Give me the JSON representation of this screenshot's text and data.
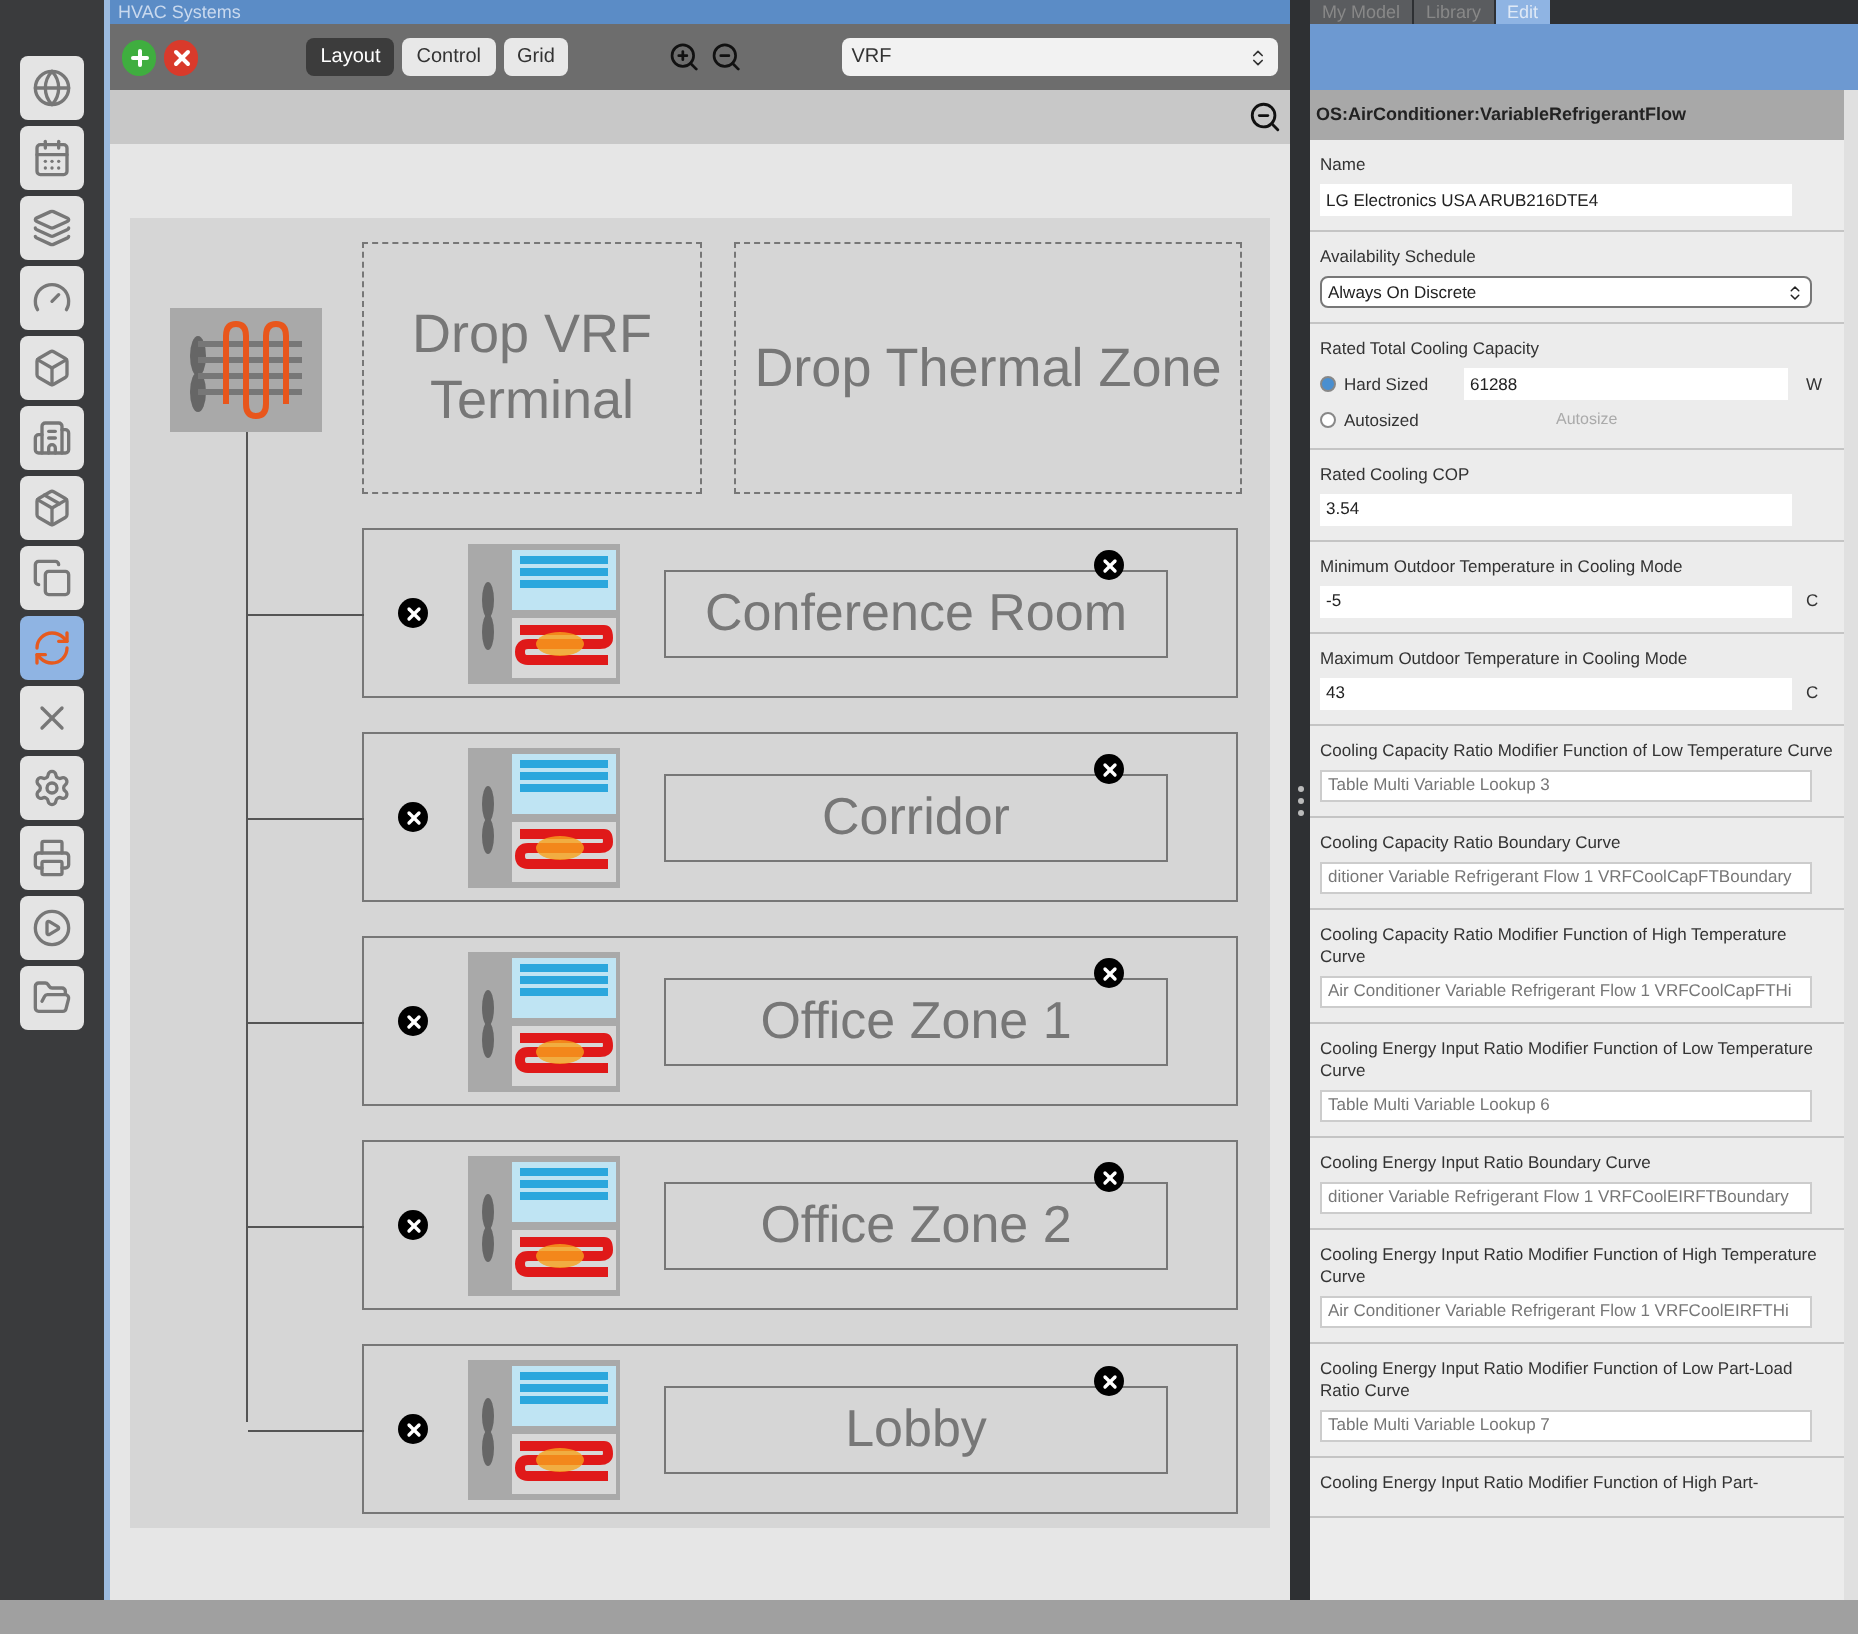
{
  "window": {
    "title": "HVAC Systems"
  },
  "sidebar": {
    "items": [
      {
        "selected": false
      },
      {
        "selected": false
      },
      {
        "selected": false
      },
      {
        "selected": false
      },
      {
        "selected": false
      },
      {
        "selected": false
      },
      {
        "selected": false
      },
      {
        "selected": false
      },
      {
        "selected": true
      },
      {
        "selected": false
      },
      {
        "selected": false
      },
      {
        "selected": false
      },
      {
        "selected": false
      },
      {
        "selected": false
      }
    ]
  },
  "toolbar": {
    "view_tabs": [
      {
        "label": "Layout",
        "selected": true
      },
      {
        "label": "Control",
        "selected": false
      },
      {
        "label": "Grid",
        "selected": false
      }
    ],
    "system_select": "VRF"
  },
  "diagram": {
    "drop_targets": [
      "Drop VRF\nTerminal",
      "Drop Thermal Zone"
    ],
    "zones": [
      "Conference Room",
      "Corridor",
      "Office Zone 1",
      "Office Zone 2",
      "Lobby"
    ]
  },
  "right_tabs": [
    {
      "label": "My Model",
      "selected": false
    },
    {
      "label": "Library",
      "selected": false
    },
    {
      "label": "Edit",
      "selected": true
    }
  ],
  "inspector": {
    "title": "OS:AirConditioner:VariableRefrigerantFlow",
    "fields": [
      {
        "kind": "text",
        "label": "Name",
        "value": "LG Electronics USA ARUB216DTE4"
      },
      {
        "kind": "select",
        "label": "Availability Schedule",
        "value": "Always On Discrete"
      },
      {
        "kind": "radio",
        "label": "Rated Total Cooling Capacity",
        "options": [
          {
            "label": "Hard Sized",
            "selected": true,
            "value": "61288",
            "unit": "W"
          },
          {
            "label": "Autosized",
            "selected": false,
            "value": "Autosize"
          }
        ]
      },
      {
        "kind": "text",
        "label": "Rated Cooling COP",
        "value": "3.54"
      },
      {
        "kind": "text",
        "label": "Minimum Outdoor Temperature in Cooling Mode",
        "value": "-5",
        "unit": "C"
      },
      {
        "kind": "text",
        "label": "Maximum Outdoor Temperature in Cooling Mode",
        "value": "43",
        "unit": "C"
      },
      {
        "kind": "curve",
        "label": "Cooling Capacity Ratio Modifier Function of Low Temperature Curve",
        "value": "Table Multi Variable Lookup 3"
      },
      {
        "kind": "curve",
        "label": "Cooling Capacity Ratio Boundary Curve",
        "value": "ditioner Variable Refrigerant Flow 1 VRFCoolCapFTBoundary"
      },
      {
        "kind": "curve",
        "label": "Cooling Capacity Ratio Modifier Function of High Temperature Curve",
        "value": "Air Conditioner Variable Refrigerant Flow 1 VRFCoolCapFTHi"
      },
      {
        "kind": "curve",
        "label": "Cooling Energy Input Ratio Modifier Function of Low Temperature Curve",
        "value": "Table Multi Variable Lookup 6"
      },
      {
        "kind": "curve",
        "label": "Cooling Energy Input Ratio Boundary Curve",
        "value": "ditioner Variable Refrigerant Flow 1 VRFCoolEIRFTBoundary"
      },
      {
        "kind": "curve",
        "label": "Cooling Energy Input Ratio Modifier Function of High Temperature Curve",
        "value": "Air Conditioner Variable Refrigerant Flow 1 VRFCoolEIRFTHi"
      },
      {
        "kind": "curve",
        "label": "Cooling Energy Input Ratio Modifier Function of Low Part-Load Ratio Curve",
        "value": "Table Multi Variable Lookup 7"
      },
      {
        "kind": "cut",
        "label": "Cooling Energy Input Ratio Modifier Function of High Part-"
      }
    ]
  }
}
